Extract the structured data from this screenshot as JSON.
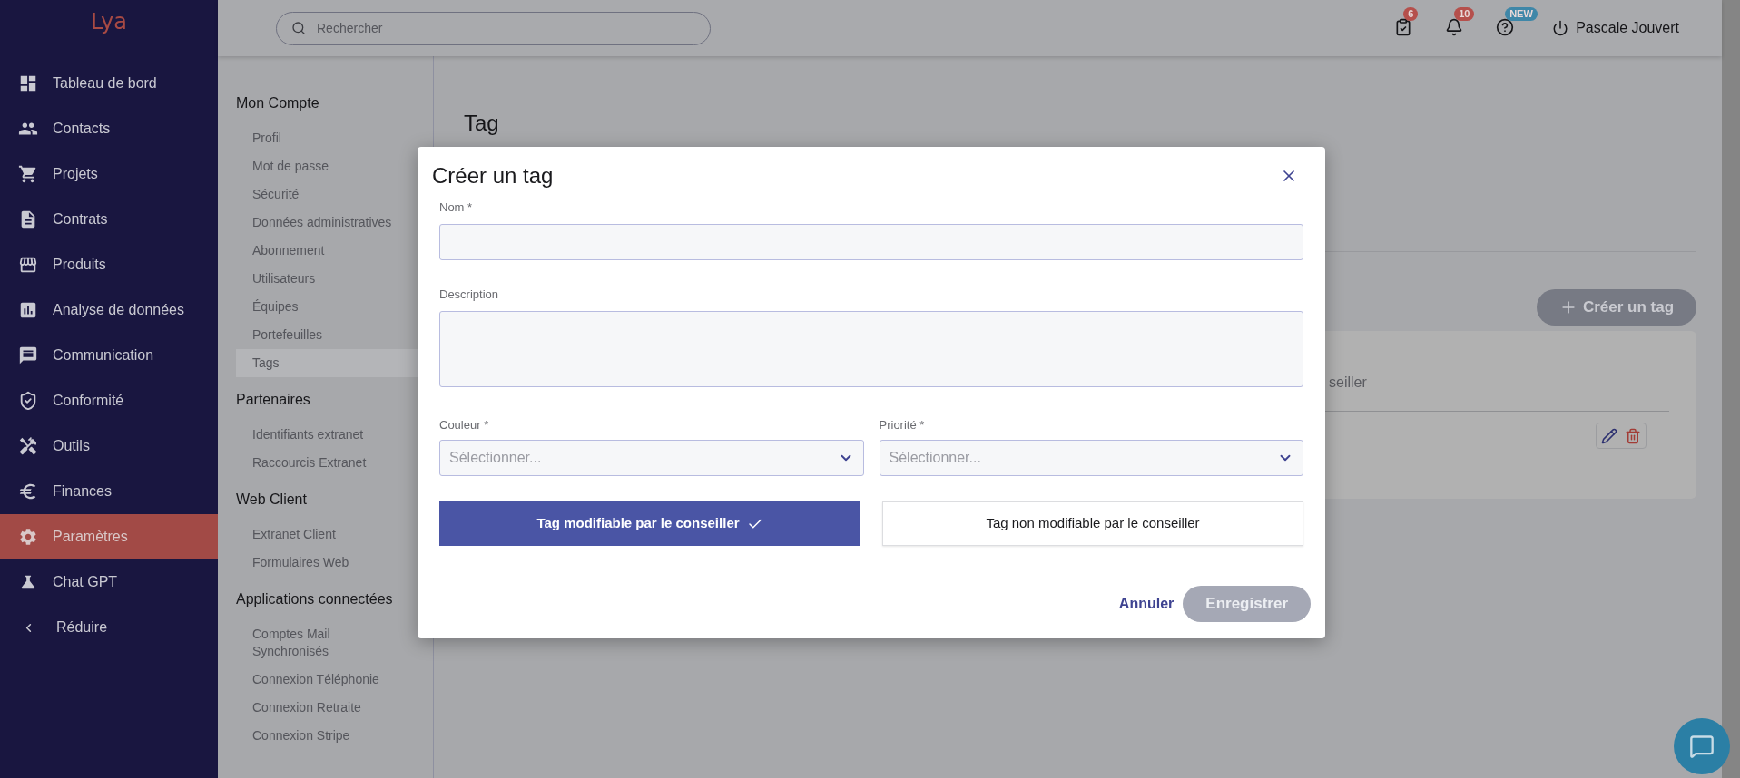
{
  "logo": "Lya",
  "sidebar": {
    "items": [
      {
        "label": "Tableau de bord",
        "selected": false
      },
      {
        "label": "Contacts",
        "selected": false
      },
      {
        "label": "Projets",
        "selected": false
      },
      {
        "label": "Contrats",
        "selected": false
      },
      {
        "label": "Produits",
        "selected": false
      },
      {
        "label": "Analyse de données",
        "selected": false
      },
      {
        "label": "Communication",
        "selected": false
      },
      {
        "label": "Conformité",
        "selected": false
      },
      {
        "label": "Outils",
        "selected": false
      },
      {
        "label": "Finances",
        "selected": false
      },
      {
        "label": "Paramètres",
        "selected": true
      },
      {
        "label": "Chat GPT",
        "selected": false
      }
    ],
    "collapse": "Réduire"
  },
  "topbar": {
    "search": {
      "placeholder": "Rechercher"
    },
    "badges": [
      {
        "count": "6",
        "color": "#b5504c"
      },
      {
        "count": "10",
        "color": "#b5504c"
      },
      {
        "count": "NEW",
        "color": "#3f87a8"
      }
    ],
    "user": "Pascale Jouvert"
  },
  "settings_menu": {
    "sections": [
      {
        "heading": "Mon Compte",
        "items": [
          {
            "label": "Profil",
            "selected": false
          },
          {
            "label": "Mot de passe",
            "selected": false
          },
          {
            "label": "Sécurité",
            "selected": false
          },
          {
            "label": "Données administratives",
            "selected": false
          },
          {
            "label": "Abonnement",
            "selected": false
          },
          {
            "label": "Utilisateurs",
            "selected": false
          },
          {
            "label": "Équipes",
            "selected": false
          },
          {
            "label": "Portefeuilles",
            "selected": false
          },
          {
            "label": "Tags",
            "selected": true
          }
        ]
      },
      {
        "heading": "Partenaires",
        "items": [
          {
            "label": "Identifiants extranet",
            "selected": false
          },
          {
            "label": "Raccourcis Extranet",
            "selected": false
          }
        ]
      },
      {
        "heading": "Web Client",
        "items": [
          {
            "label": "Extranet Client",
            "selected": false
          },
          {
            "label": "Formulaires Web",
            "selected": false
          }
        ]
      },
      {
        "heading": "Applications connectées",
        "items": [
          {
            "label": "Comptes Mail Synchronisés",
            "selected": false
          },
          {
            "label": "Connexion Téléphonie",
            "selected": false
          },
          {
            "label": "Connexion Retraite",
            "selected": false
          },
          {
            "label": "Connexion Stripe",
            "selected": false
          }
        ]
      }
    ]
  },
  "page": {
    "title": "Tag",
    "create_button": "Créer un tag",
    "card": {
      "text": "seiller"
    }
  },
  "modal": {
    "title": "Créer un tag",
    "fields": [
      {
        "label": "Nom *",
        "kind": "input"
      },
      {
        "label": "Description",
        "kind": "textarea"
      }
    ],
    "selects": [
      {
        "label": "Couleur *",
        "placeholder": "Sélectionner..."
      },
      {
        "label": "Priorité *",
        "placeholder": "Sélectionner..."
      }
    ],
    "options": [
      {
        "label": "Tag modifiable par le conseiller",
        "selected": true
      },
      {
        "label": "Tag non modifiable par le conseiller",
        "selected": false
      }
    ],
    "cancel": "Annuler",
    "save": {
      "label": "Enregistrer",
      "disabled": true
    }
  }
}
